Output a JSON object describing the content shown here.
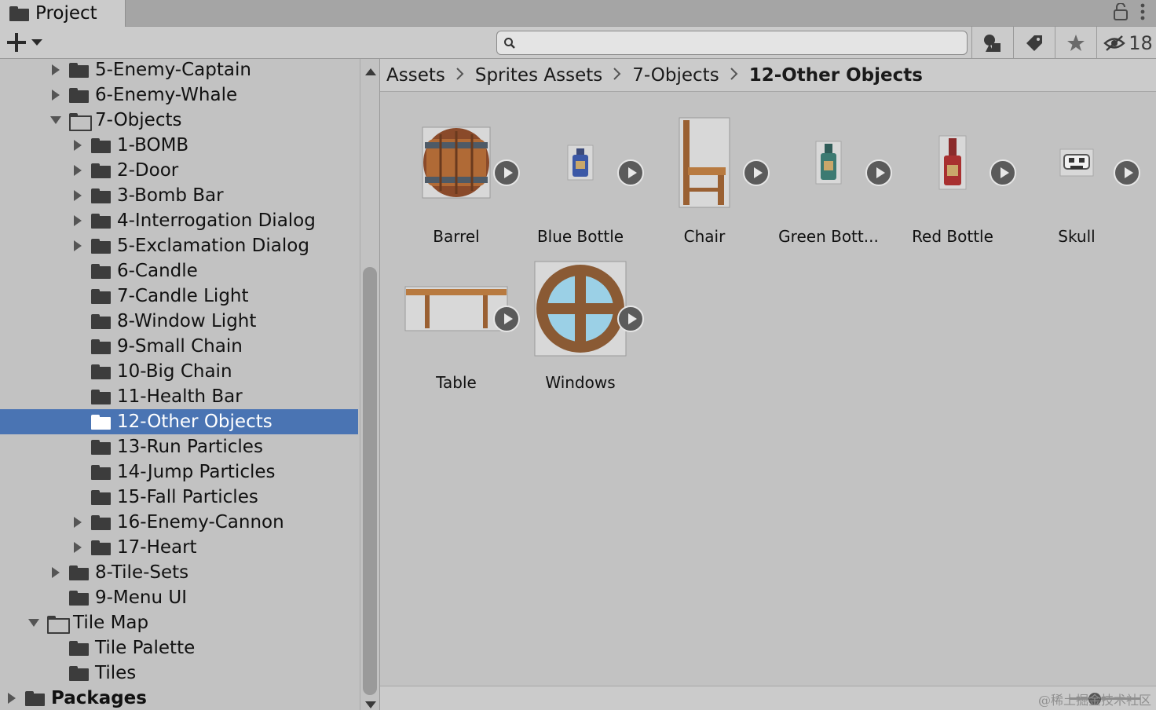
{
  "tab": {
    "title": "Project"
  },
  "toolbar": {
    "create_icon": "plus-icon",
    "search_placeholder": "",
    "hidden_count": "18"
  },
  "tree": [
    {
      "label": "5-Enemy-Captain",
      "depth": 2,
      "expander": "collapsed",
      "folder": "closed"
    },
    {
      "label": "6-Enemy-Whale",
      "depth": 2,
      "expander": "collapsed",
      "folder": "closed"
    },
    {
      "label": "7-Objects",
      "depth": 2,
      "expander": "expanded",
      "folder": "open"
    },
    {
      "label": "1-BOMB",
      "depth": 3,
      "expander": "collapsed",
      "folder": "closed"
    },
    {
      "label": "2-Door",
      "depth": 3,
      "expander": "collapsed",
      "folder": "closed"
    },
    {
      "label": "3-Bomb Bar",
      "depth": 3,
      "expander": "collapsed",
      "folder": "closed"
    },
    {
      "label": "4-Interrogation Dialog",
      "depth": 3,
      "expander": "collapsed",
      "folder": "closed"
    },
    {
      "label": "5-Exclamation Dialog",
      "depth": 3,
      "expander": "collapsed",
      "folder": "closed"
    },
    {
      "label": "6-Candle",
      "depth": 3,
      "expander": "none",
      "folder": "closed"
    },
    {
      "label": "7-Candle Light",
      "depth": 3,
      "expander": "none",
      "folder": "closed"
    },
    {
      "label": "8-Window Light",
      "depth": 3,
      "expander": "none",
      "folder": "closed"
    },
    {
      "label": "9-Small Chain",
      "depth": 3,
      "expander": "none",
      "folder": "closed"
    },
    {
      "label": "10-Big Chain",
      "depth": 3,
      "expander": "none",
      "folder": "closed"
    },
    {
      "label": "11-Health Bar",
      "depth": 3,
      "expander": "none",
      "folder": "closed"
    },
    {
      "label": "12-Other Objects",
      "depth": 3,
      "expander": "none",
      "folder": "closed",
      "selected": true
    },
    {
      "label": "13-Run Particles",
      "depth": 3,
      "expander": "none",
      "folder": "closed"
    },
    {
      "label": "14-Jump Particles",
      "depth": 3,
      "expander": "none",
      "folder": "closed"
    },
    {
      "label": "15-Fall Particles",
      "depth": 3,
      "expander": "none",
      "folder": "closed"
    },
    {
      "label": "16-Enemy-Cannon",
      "depth": 3,
      "expander": "collapsed",
      "folder": "closed"
    },
    {
      "label": "17-Heart",
      "depth": 3,
      "expander": "collapsed",
      "folder": "closed"
    },
    {
      "label": "8-Tile-Sets",
      "depth": 2,
      "expander": "collapsed",
      "folder": "closed"
    },
    {
      "label": "9-Menu UI",
      "depth": 2,
      "expander": "none",
      "folder": "closed"
    },
    {
      "label": "Tile Map",
      "depth": 1,
      "expander": "expanded",
      "folder": "open"
    },
    {
      "label": "Tile Palette",
      "depth": 2,
      "expander": "none",
      "folder": "closed"
    },
    {
      "label": "Tiles",
      "depth": 2,
      "expander": "none",
      "folder": "closed"
    },
    {
      "label": "Packages",
      "depth": 0,
      "expander": "collapsed",
      "folder": "closed",
      "bold": true
    }
  ],
  "breadcrumb": [
    "Assets",
    "Sprites Assets",
    "7-Objects",
    "12-Other Objects"
  ],
  "assets": [
    {
      "name": "Barrel",
      "icon": "barrel-sprite-icon"
    },
    {
      "name": "Blue Bottle",
      "icon": "blue-bottle-sprite-icon"
    },
    {
      "name": "Chair",
      "icon": "chair-sprite-icon"
    },
    {
      "name": "Green Bott...",
      "icon": "green-bottle-sprite-icon"
    },
    {
      "name": "Red Bottle",
      "icon": "red-bottle-sprite-icon"
    },
    {
      "name": "Skull",
      "icon": "skull-sprite-icon"
    },
    {
      "name": "Table",
      "icon": "table-sprite-icon"
    },
    {
      "name": "Windows",
      "icon": "window-sprite-icon"
    }
  ],
  "watermark": "@稀土掘金技术社区",
  "colors": {
    "selection": "#4a74b3",
    "panel_bg": "#c2c2c2",
    "toolbar_bg": "#cbcbcb"
  }
}
